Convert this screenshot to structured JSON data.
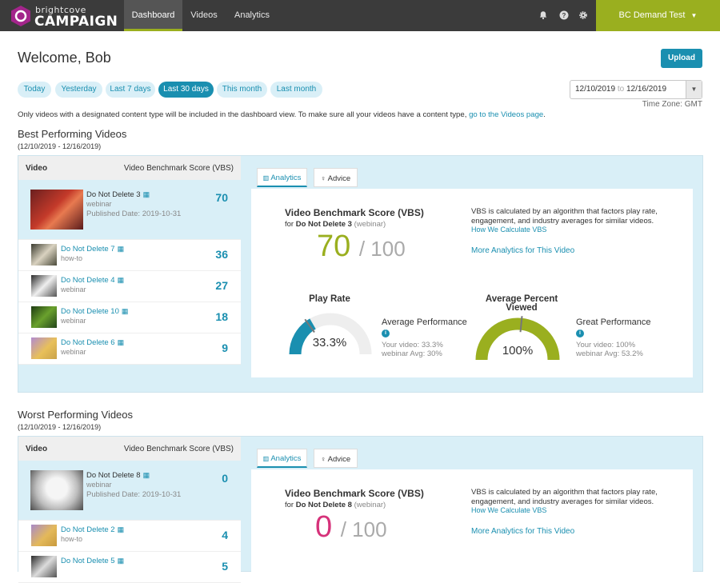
{
  "nav": {
    "brand_top": "brightcove",
    "brand_main": "CAMPAIGN",
    "tabs": [
      "Dashboard",
      "Videos",
      "Analytics"
    ],
    "account": "BC Demand Test",
    "icons": [
      "bell-icon",
      "help-icon",
      "gear-icon"
    ]
  },
  "header": {
    "welcome": "Welcome, Bob",
    "upload": "Upload"
  },
  "filters": {
    "ranges": [
      "Today",
      "Yesterday",
      "Last 7 days",
      "Last 30 days",
      "This month",
      "Last month"
    ],
    "active": "Last 30 days",
    "date_from": "12/10/2019",
    "date_to_word": "to",
    "date_to": "12/16/2019",
    "timezone": "Time Zone: GMT"
  },
  "notice": {
    "text": "Only videos with a designated content type will be included in the dashboard view. To make sure all your videos have a content type,",
    "link": "go to the Videos page",
    "end": "."
  },
  "best": {
    "title": "Best Performing Videos",
    "range": "(12/10/2019 - 12/16/2019)",
    "col_video": "Video",
    "col_score": "Video Benchmark Score (VBS)",
    "videos": [
      {
        "title": "Do Not Delete 3",
        "type": "webinar",
        "published": "Published Date: 2019-10-31",
        "score": "70"
      },
      {
        "title": "Do Not Delete 7",
        "type": "how-to",
        "score": "36"
      },
      {
        "title": "Do Not Delete 4",
        "type": "webinar",
        "score": "27"
      },
      {
        "title": "Do Not Delete 10",
        "type": "webinar",
        "score": "18"
      },
      {
        "title": "Do Not Delete 6",
        "type": "webinar",
        "score": "9"
      }
    ],
    "tabs": [
      "Analytics",
      "Advice"
    ],
    "vbs_title": "Video Benchmark Score (VBS)",
    "vbs_for": "for",
    "vbs_video": "Do Not Delete 3",
    "vbs_type": "(webinar)",
    "vbs_score": "70",
    "vbs_of": "/ 100",
    "vbs_color": "#9aaf1f",
    "desc": "VBS is calculated by an algorithm that factors play rate, engagement, and industry averages for similar videos.",
    "how_link": "How We Calculate VBS",
    "more_link": "More Analytics for This Video",
    "play_rate_title": "Play Rate",
    "play_rate_value": "33.3%",
    "play_rate_fraction": 0.333,
    "play_rate_perf": "Average Performance",
    "play_rate_your": "Your video: 33.3%",
    "play_rate_avg": "webinar Avg: 30%",
    "apv_title": "Average Percent Viewed",
    "apv_value": "100%",
    "apv_fraction": 1.0,
    "apv_perf": "Great Performance",
    "apv_your": "Your video: 100%",
    "apv_avg": "webinar Avg: 53.2%"
  },
  "worst": {
    "title": "Worst Performing Videos",
    "range": "(12/10/2019 - 12/16/2019)",
    "col_video": "Video",
    "col_score": "Video Benchmark Score (VBS)",
    "videos": [
      {
        "title": "Do Not Delete 8",
        "type": "webinar",
        "published": "Published Date: 2019-10-31",
        "score": "0"
      },
      {
        "title": "Do Not Delete 2",
        "type": "how-to",
        "score": "4"
      },
      {
        "title": "Do Not Delete 5",
        "type": "",
        "score": "5"
      }
    ],
    "tabs": [
      "Analytics",
      "Advice"
    ],
    "vbs_title": "Video Benchmark Score (VBS)",
    "vbs_for": "for",
    "vbs_video": "Do Not Delete 8",
    "vbs_type": "(webinar)",
    "vbs_score": "0",
    "vbs_of": "/ 100",
    "vbs_color": "#d6327a",
    "desc": "VBS is calculated by an algorithm that factors play rate, engagement, and industry averages for similar videos.",
    "how_link": "How We Calculate VBS",
    "more_link": "More Analytics for This Video"
  },
  "colors": {
    "accent": "#1a8fb0",
    "brand": "#9aaf1f",
    "nav": "#3b3b3b"
  }
}
